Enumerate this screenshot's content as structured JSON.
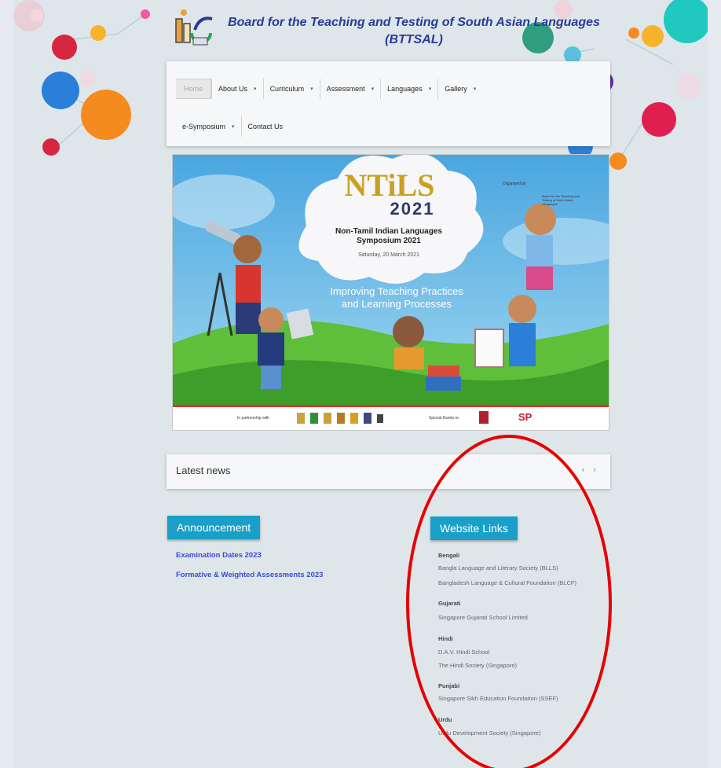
{
  "site": {
    "title_line1": "Board for the Teaching and Testing of South Asian Languages",
    "title_line2": "(BTTSAL)"
  },
  "nav": {
    "home": "Home",
    "items_row1": [
      {
        "label": "About Us",
        "dropdown": true
      },
      {
        "label": "Curriculum",
        "dropdown": true
      },
      {
        "label": "Assessment",
        "dropdown": true
      },
      {
        "label": "Languages",
        "dropdown": true
      },
      {
        "label": "Gallery",
        "dropdown": true
      }
    ],
    "items_row2": [
      {
        "label": "e-Symposium",
        "dropdown": true
      },
      {
        "label": "Contact Us",
        "dropdown": false
      }
    ]
  },
  "banner": {
    "logo_text": "NTiLS",
    "year": "2021",
    "subtitle": "Non-Tamil Indian Languages Symposium 2021",
    "date": "Saturday, 20 March 2021",
    "tagline1": "Improving Teaching Practices",
    "tagline2": "and Learning Processes",
    "organised_by": "Organised by",
    "org_name": "Board for the Teaching and Testing of South Asian Languages",
    "in_partnership": "In partnership with",
    "special_thanks": "Special thanks to",
    "partner_sp": "SP"
  },
  "news": {
    "title": "Latest news",
    "controls": "‹ ›"
  },
  "announcement": {
    "title": "Announcement",
    "links": [
      "Examination Dates 2023",
      "Formative & Weighted Assessments 2023"
    ]
  },
  "website_links": {
    "title": "Website Links",
    "groups": [
      {
        "lang": "Bengali",
        "links": [
          "Bangla Language and Literary Society (BLLS)",
          "Bangladesh Language & Cultural Foundation (BLCF)"
        ]
      },
      {
        "lang": "Gujarati",
        "links": [
          "Singapore Gujarati School Limited"
        ]
      },
      {
        "lang": "Hindi",
        "links": [
          "D.A.V. Hindi School",
          "The Hindi Society (Singapore)"
        ]
      },
      {
        "lang": "Punjabi",
        "links": [
          "Singapore Sikh Education Foundation (SSEF)"
        ]
      },
      {
        "lang": "Urdu",
        "links": [
          "Urdu Development Society (Singapore)"
        ]
      }
    ]
  },
  "colors": {
    "accent": "#1aa0c8",
    "title": "#2a3a9a",
    "link": "#3a4ad8",
    "highlight": "#e60000"
  }
}
